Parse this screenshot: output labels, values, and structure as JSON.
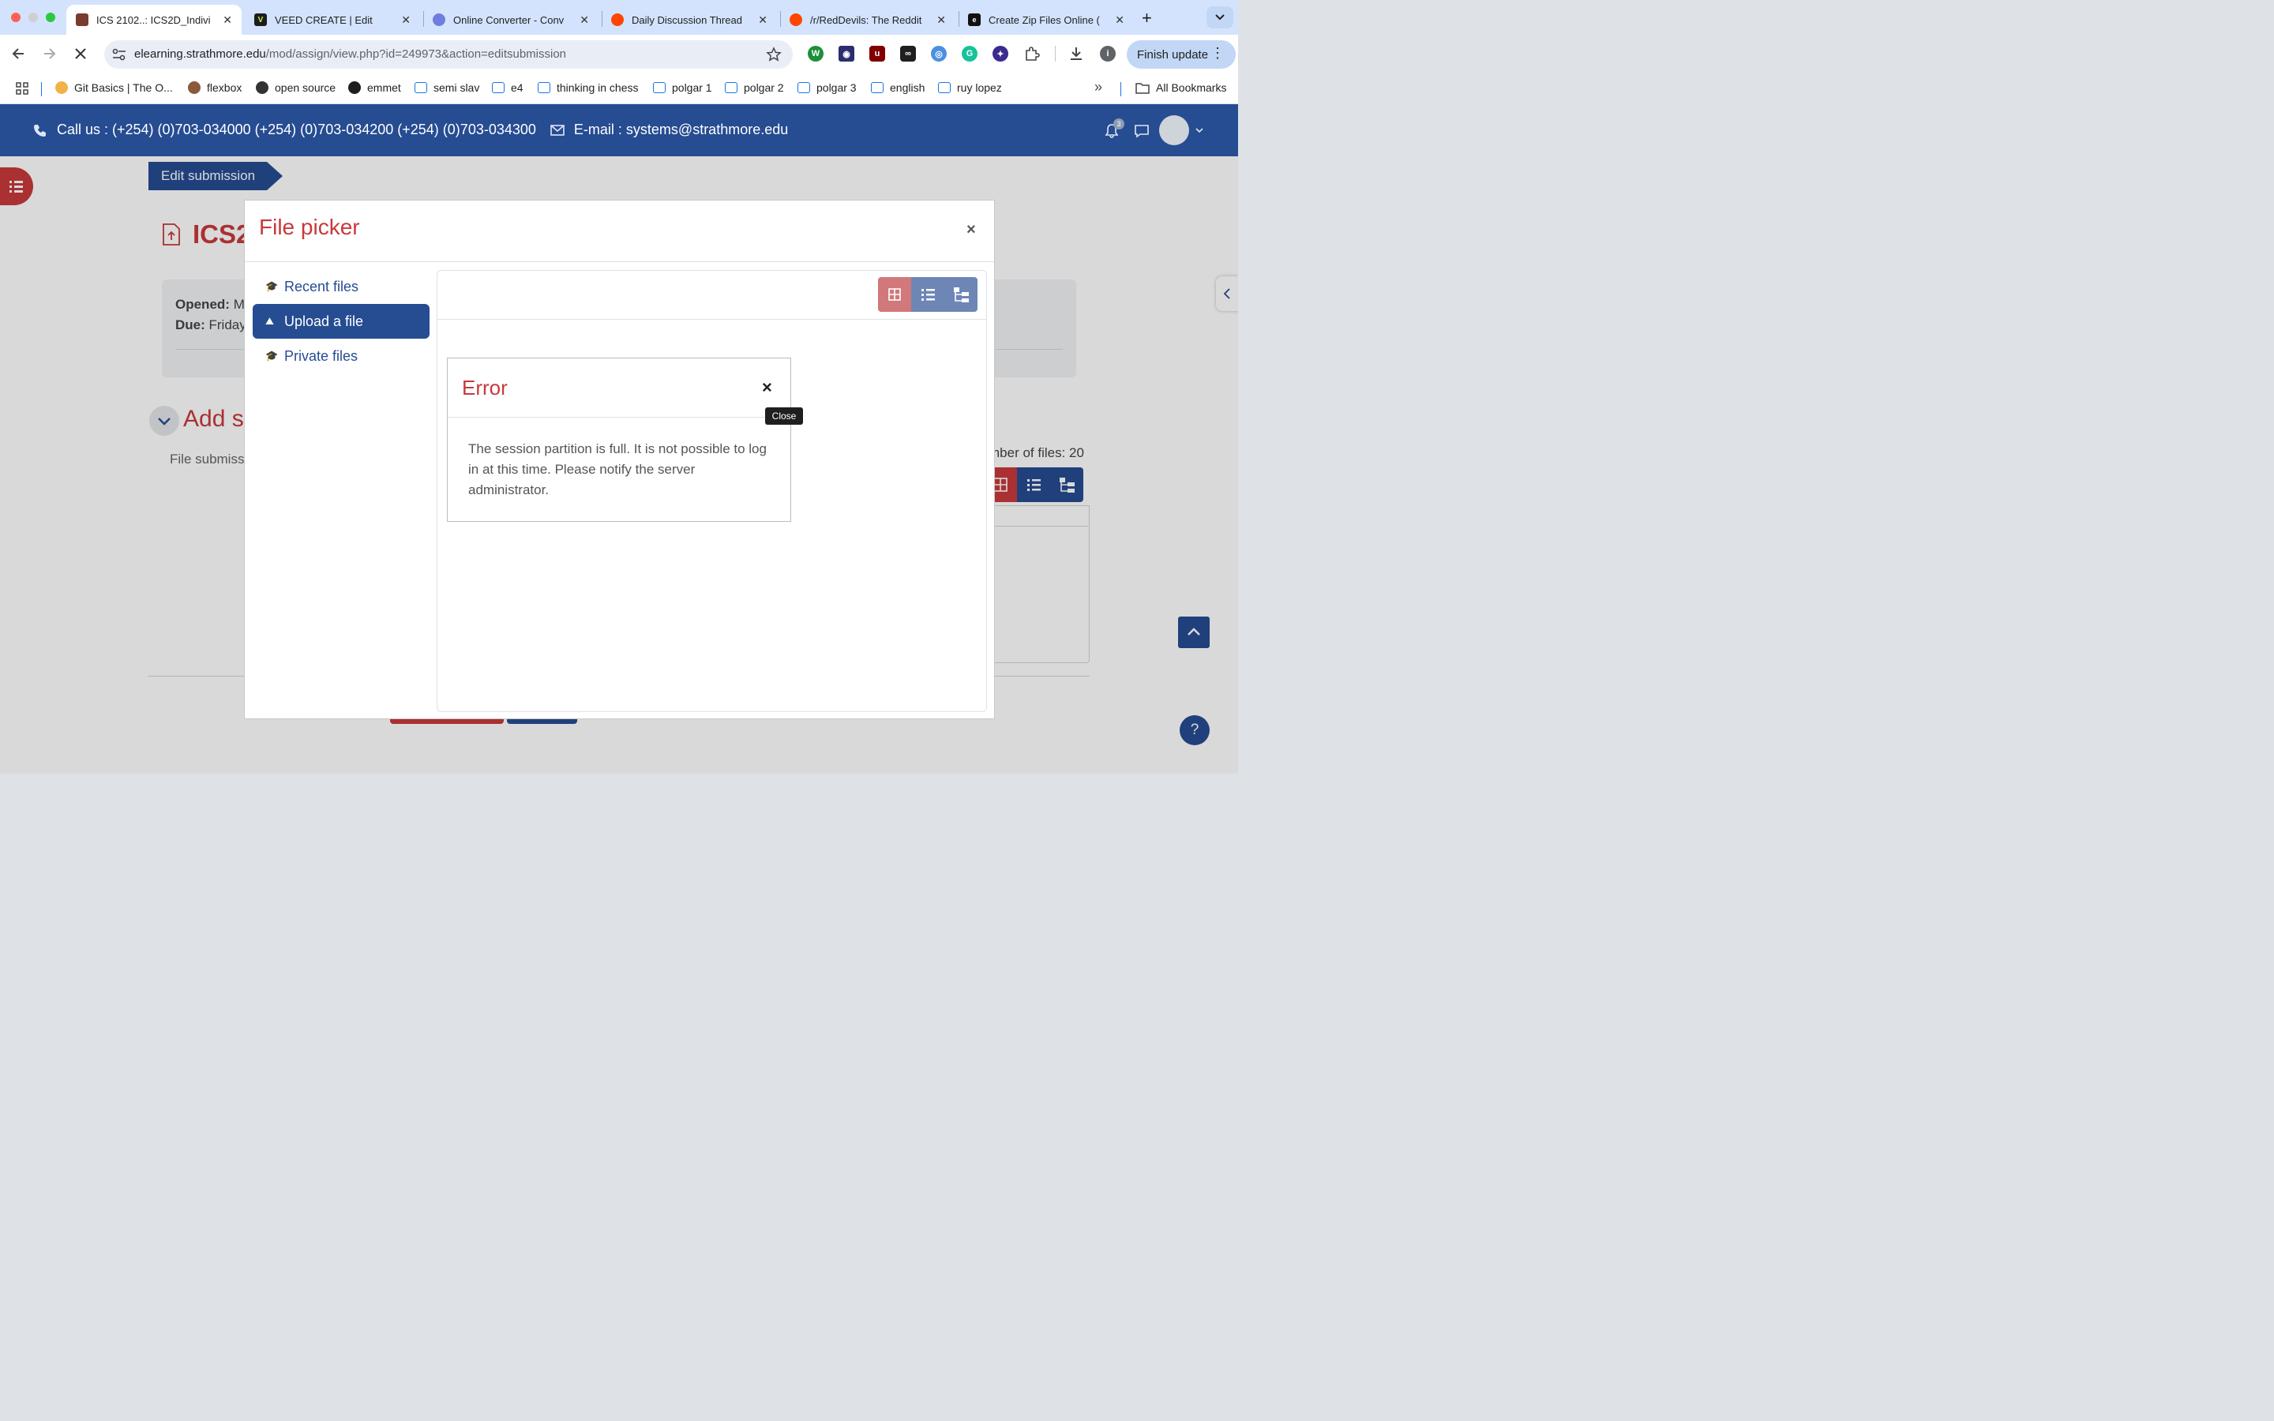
{
  "browser": {
    "tabs": [
      {
        "title": "ICS 2102..: ICS2D_Indivi",
        "favicon_color": "#7a3b2e",
        "active": true
      },
      {
        "title": "VEED CREATE | Edit",
        "favicon_color": "#1c1c1c"
      },
      {
        "title": "Online Converter - Conv",
        "favicon_color": "#6f7de0"
      },
      {
        "title": "Daily Discussion Thread",
        "favicon_color": "#ff4500"
      },
      {
        "title": "/r/RedDevils: The Reddit",
        "favicon_color": "#ff4500"
      },
      {
        "title": "Create Zip Files Online (",
        "favicon_color": "#111111"
      }
    ],
    "new_tab_label": "+",
    "url_host": "elearning.strathmore.edu",
    "url_path": "/mod/assign/view.php?id=249973&action=editsubmission",
    "finish_update_label": "Finish update",
    "bookmarks": [
      {
        "label": "Git Basics | The O..."
      },
      {
        "label": "flexbox"
      },
      {
        "label": "open source"
      },
      {
        "label": "emmet"
      },
      {
        "label": "semi slav"
      },
      {
        "label": "e4"
      },
      {
        "label": "thinking in chess"
      },
      {
        "label": "polgar 1"
      },
      {
        "label": "polgar 2"
      },
      {
        "label": "polgar 3"
      },
      {
        "label": "english"
      },
      {
        "label": "ruy lopez"
      }
    ],
    "overflow_label": "»",
    "all_bookmarks_label": "All Bookmarks"
  },
  "site": {
    "contact": "Call us : (+254) (0)703-034000 (+254) (0)703-034200 (+254) (0)703-034300",
    "email": "E-mail : systems@strathmore.edu",
    "notification_count": "3",
    "breadcrumb": "Edit submission",
    "page_title_partial": "ICS2",
    "opened_label": "Opened:",
    "opened_value": "M",
    "due_label": "Due:",
    "due_value": "Friday",
    "section_title_partial": "Add su",
    "file_submissions_partial": "File submiss",
    "max_files_partial": "mber of files: 20"
  },
  "file_picker": {
    "title": "File picker",
    "close": "×",
    "nav": [
      {
        "label": "Recent files",
        "active": false
      },
      {
        "label": "Upload a file",
        "active": true
      },
      {
        "label": "Private files",
        "active": false
      }
    ]
  },
  "error_dialog": {
    "title": "Error",
    "close": "×",
    "message": "The session partition is full. It is not possible to log in at this time. Please notify the server administrator.",
    "tooltip": "Close"
  },
  "colors": {
    "moodle_blue": "#264c92",
    "moodle_red": "#c8393b",
    "chrome_tabbar": "#d3e3fd"
  }
}
